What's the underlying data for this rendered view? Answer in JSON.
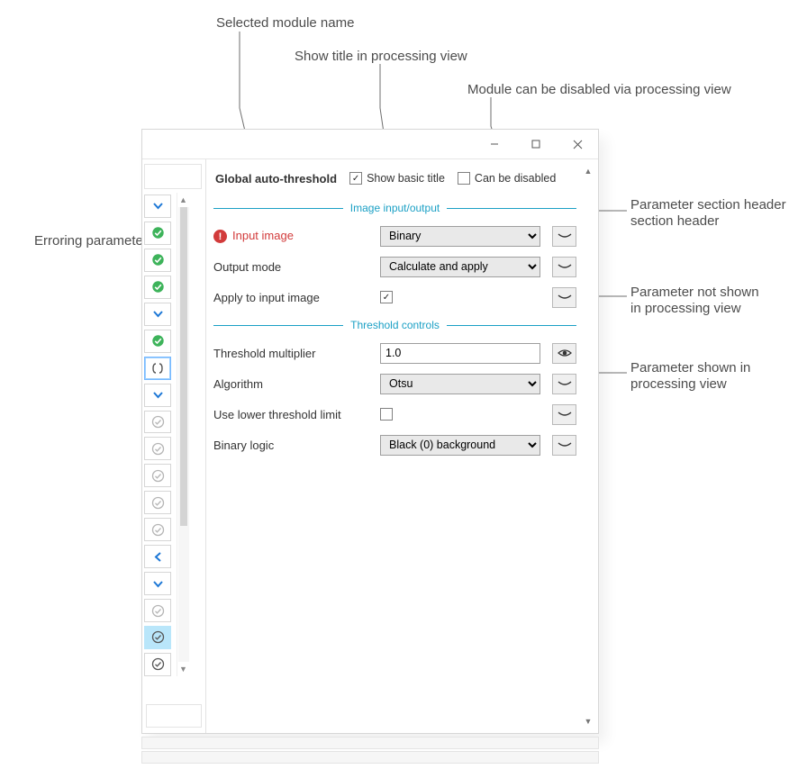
{
  "annotations": {
    "module_name": "Selected module name",
    "show_title": "Show title in processing view",
    "can_disable": "Module can be disabled via processing view",
    "erroring": "Erroring parameter",
    "section_header": "Parameter section header",
    "not_shown": "Parameter not shown in processing view",
    "shown": "Parameter shown in processing view"
  },
  "header": {
    "module_title": "Global auto-threshold",
    "show_basic_title": {
      "label": "Show basic title",
      "checked": true
    },
    "can_be_disabled": {
      "label": "Can be disabled",
      "checked": false
    }
  },
  "sections": [
    {
      "title": "Image input/output",
      "rows": [
        {
          "id": "input_image",
          "label": "Input image",
          "error": true,
          "control": "select",
          "value": "Binary",
          "visibility": "hidden"
        },
        {
          "id": "output_mode",
          "label": "Output mode",
          "control": "select",
          "value": "Calculate and apply",
          "visibility": "hidden"
        },
        {
          "id": "apply_input",
          "label": "Apply to input image",
          "control": "checkbox",
          "checked": true,
          "visibility": "hidden"
        }
      ]
    },
    {
      "title": "Threshold controls",
      "rows": [
        {
          "id": "thresh_mult",
          "label": "Threshold multiplier",
          "control": "text",
          "value": "1.0",
          "visibility": "shown"
        },
        {
          "id": "algorithm",
          "label": "Algorithm",
          "control": "select",
          "value": "Otsu",
          "visibility": "hidden"
        },
        {
          "id": "use_lower",
          "label": "Use lower threshold limit",
          "control": "checkbox",
          "checked": false,
          "visibility": "hidden"
        },
        {
          "id": "binary_logic",
          "label": "Binary logic",
          "control": "select",
          "value": "Black (0) background",
          "visibility": "hidden"
        }
      ]
    }
  ],
  "sidebar_glyphs": [
    {
      "glyph": "v",
      "cls": "blue"
    },
    {
      "glyph": "check",
      "cls": "green"
    },
    {
      "glyph": "check",
      "cls": "green"
    },
    {
      "glyph": "check",
      "cls": "green"
    },
    {
      "glyph": "v",
      "cls": "blue"
    },
    {
      "glyph": "check",
      "cls": "green"
    },
    {
      "glyph": "brackets",
      "cls": "boxed",
      "selected": true
    },
    {
      "glyph": "v",
      "cls": "blue"
    },
    {
      "glyph": "ccheck",
      "cls": "gray"
    },
    {
      "glyph": "ccheck",
      "cls": "gray"
    },
    {
      "glyph": "ccheck",
      "cls": "gray"
    },
    {
      "glyph": "ccheck",
      "cls": "gray"
    },
    {
      "glyph": "ccheck",
      "cls": "gray"
    },
    {
      "glyph": "left",
      "cls": "blue"
    },
    {
      "glyph": "v",
      "cls": "blue"
    },
    {
      "glyph": "ccheck",
      "cls": "gray"
    },
    {
      "glyph": "ccheck2",
      "cls": "boxed",
      "highlight": true
    },
    {
      "glyph": "ccheck2",
      "cls": "boxed"
    }
  ]
}
